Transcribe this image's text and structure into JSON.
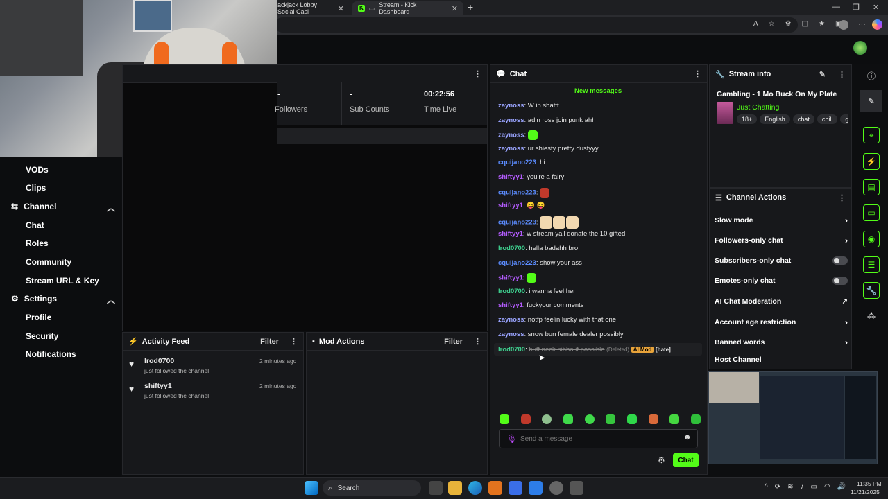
{
  "browser": {
    "tabs": [
      {
        "label": "ackjack Lobby Social Casi"
      },
      {
        "label": "Stream - Kick Dashboard"
      }
    ],
    "new_tab": "+"
  },
  "stats": [
    {
      "value": "-",
      "label": "Followers"
    },
    {
      "value": "-",
      "label": "Sub Counts"
    },
    {
      "value": "00:22:56",
      "label": "Time Live"
    }
  ],
  "sidebar": {
    "items": [
      "VODs",
      "Clips"
    ],
    "channel": {
      "label": "Channel",
      "items": [
        "Chat",
        "Roles",
        "Community",
        "Stream URL & Key"
      ]
    },
    "settings": {
      "label": "Settings",
      "items": [
        "Profile",
        "Security",
        "Notifications"
      ]
    }
  },
  "activity": {
    "title": "Activity Feed",
    "filter": "Filter",
    "items": [
      {
        "user": "lrod0700",
        "action": "just followed the channel",
        "time": "2 minutes ago"
      },
      {
        "user": "shiftyy1",
        "action": "just followed the channel",
        "time": "2 minutes ago"
      }
    ]
  },
  "mod_actions": {
    "title": "Mod Actions",
    "filter": "Filter"
  },
  "chat": {
    "title": "Chat",
    "new_messages": "New messages",
    "messages": [
      {
        "user": "zaynoss",
        "color": "#9aa4ff",
        "text": "W in shattt"
      },
      {
        "user": "zaynoss",
        "color": "#9aa4ff",
        "text": "adin ross join punk ahh"
      },
      {
        "user": "zaynoss",
        "color": "#9aa4ff",
        "text": "",
        "emotes": 1
      },
      {
        "user": "zaynoss",
        "color": "#9aa4ff",
        "text": "ur shiesty pretty dustyyy"
      },
      {
        "user": "cquijano223",
        "color": "#5b8cff",
        "text": "hi"
      },
      {
        "user": "shiftyy1",
        "color": "#b45cff",
        "text": "you're a fairy"
      },
      {
        "user": "cquijano223",
        "color": "#5b8cff",
        "text": "",
        "emotes": 1
      },
      {
        "user": "shiftyy1",
        "color": "#b45cff",
        "text": "😝 😝"
      },
      {
        "user": "cquijano223",
        "color": "#5b8cff",
        "text": "",
        "emotes": 3
      },
      {
        "user": "shiftyy1",
        "color": "#b45cff",
        "text": "w stream yall donate the 10 gifted"
      },
      {
        "user": "lrod0700",
        "color": "#3ecf8e",
        "text": "hella badahh bro"
      },
      {
        "user": "cquijano223",
        "color": "#5b8cff",
        "text": "show your ass"
      },
      {
        "user": "shiftyy1",
        "color": "#b45cff",
        "text": "",
        "emotes": 1
      },
      {
        "user": "lrod0700",
        "color": "#3ecf8e",
        "text": "i wanna feel her"
      },
      {
        "user": "shiftyy1",
        "color": "#b45cff",
        "text": "fuckyour comments"
      },
      {
        "user": "zaynoss",
        "color": "#9aa4ff",
        "text": "notfp feelin lucky with that one"
      },
      {
        "user": "zaynoss",
        "color": "#9aa4ff",
        "text": "snow bun female dealer possibly"
      }
    ],
    "deleted": {
      "user": "lrod0700",
      "text": "buff neck nibba if possible",
      "deleted_label": "(Deleted)",
      "aimod_label": "AI Mod",
      "reason": "[hate]"
    },
    "placeholder": "Send a message",
    "send": "Chat"
  },
  "stream_info": {
    "title": "Stream info",
    "stream_title": "Gambling - 1 Mo Buck On My Plate",
    "category": "Just Chatting",
    "tags": [
      "18+",
      "English",
      "chat",
      "chill",
      "gam"
    ]
  },
  "channel_actions": {
    "title": "Channel Actions",
    "items": [
      {
        "label": "Slow mode",
        "kind": "chevron"
      },
      {
        "label": "Followers-only chat",
        "kind": "chevron"
      },
      {
        "label": "Subscribers-only chat",
        "kind": "toggle"
      },
      {
        "label": "Emotes-only chat",
        "kind": "toggle"
      },
      {
        "label": "AI Chat Moderation",
        "kind": "external"
      },
      {
        "label": "Account age restriction",
        "kind": "chevron"
      },
      {
        "label": "Banned words",
        "kind": "chevron"
      },
      {
        "label": "Host Channel",
        "kind": "none"
      }
    ]
  },
  "taskbar": {
    "search": "Search",
    "time": "11:35 PM",
    "date": "11/21/2025"
  },
  "colors": {
    "accent": "#53fc18",
    "panel": "#17181b",
    "background": "#0d0e10"
  }
}
